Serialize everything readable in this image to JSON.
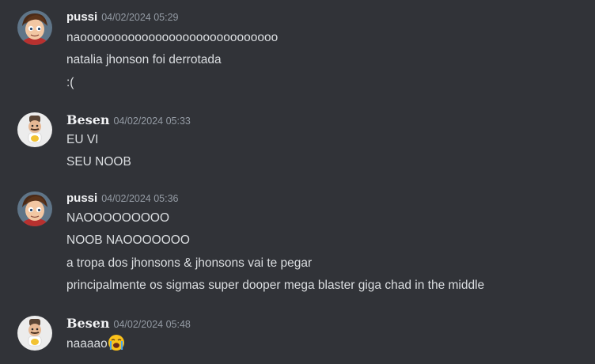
{
  "messages": [
    {
      "username": "pussi",
      "timestamp": "04/02/2024 05:29",
      "avatar_icon": "boy-cartoon-avatar-icon",
      "lines": [
        "naooooooooooooooooooooooooooooo",
        "natalia jhonson foi derrotada",
        ":("
      ]
    },
    {
      "username": "Besen",
      "timestamp": "04/02/2024 05:33",
      "avatar_icon": "chef-cartoon-avatar-icon",
      "lines": [
        "EU VI",
        "SEU NOOB"
      ]
    },
    {
      "username": "pussi",
      "timestamp": "04/02/2024 05:36",
      "avatar_icon": "boy-cartoon-avatar-icon",
      "lines": [
        "NAOOOOOOOOO",
        "NOOB NAOOOOOOO",
        "a tropa dos jhonsons & jhonsons vai te pegar",
        "principalmente os sigmas super dooper mega blaster giga chad in the middle"
      ]
    },
    {
      "username": "Besen",
      "timestamp": "04/02/2024 05:48",
      "avatar_icon": "chef-cartoon-avatar-icon",
      "lines": [
        "naaaao"
      ],
      "emoji": "loudly-crying-face-icon"
    }
  ],
  "colors": {
    "background": "#313338",
    "username": "#f2f3f5",
    "timestamp": "#949ba4",
    "text": "#dbdee1"
  }
}
